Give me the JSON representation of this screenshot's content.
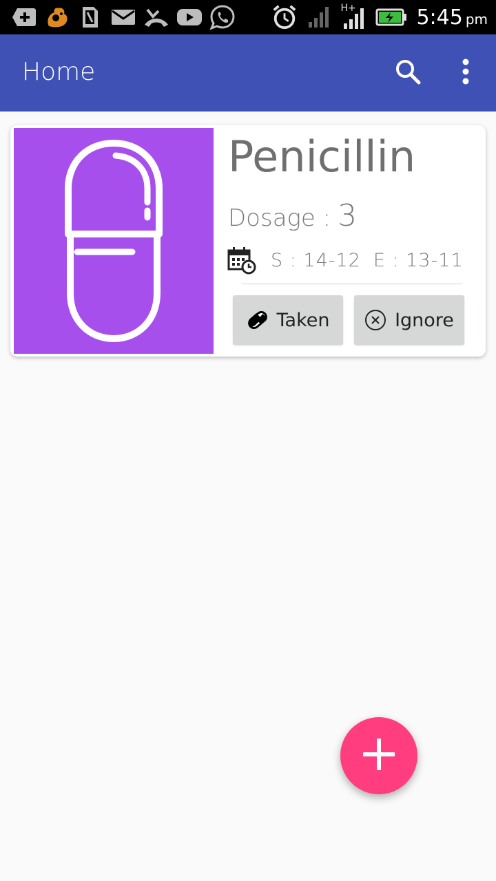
{
  "status_bar": {
    "icons": [
      "add-box-icon",
      "uc-browser-icon",
      "sim-card-icon",
      "email-icon",
      "missed-call-icon",
      "youtube-icon",
      "whatsapp-icon",
      "alarm-icon",
      "signal-icon",
      "signal-hplus-icon",
      "battery-charging-icon"
    ],
    "network_label": "H+",
    "time": "5:45",
    "ampm": "pm"
  },
  "app_bar": {
    "title": "Home",
    "background": "#3f51b5",
    "actions": [
      "search-icon",
      "more-vert-icon"
    ]
  },
  "medication_card": {
    "name": "Penicillin",
    "image_icon": "capsule-icon",
    "image_background": "#a64fec",
    "dosage_label": "Dosage :",
    "dosage_value": "3",
    "date_icon": "calendar-clock-icon",
    "start_date": "S : 14-12",
    "end_date": "E : 13-11",
    "buttons": {
      "taken_label": "Taken",
      "taken_icon": "pill-icon",
      "ignore_label": "Ignore",
      "ignore_icon": "cancel-circle-icon"
    }
  },
  "fab": {
    "icon": "plus-icon",
    "color": "#ff3d7f"
  }
}
